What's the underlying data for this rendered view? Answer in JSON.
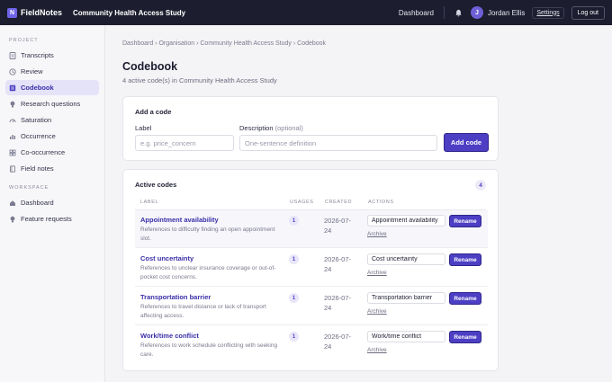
{
  "topbar": {
    "brand_initial": "N",
    "brand": "FieldNotes",
    "study_title": "Community Health Access Study",
    "dashboard": "Dashboard",
    "user_initial": "J",
    "user_name": "Jordan Ellis",
    "settings": "Settings",
    "logout": "Log out"
  },
  "sidebar": {
    "project_section": "PROJECT",
    "workspace_section": "WORKSPACE",
    "project_items": [
      {
        "label": "Transcripts",
        "icon": "document-icon"
      },
      {
        "label": "Review",
        "icon": "clock-icon"
      },
      {
        "label": "Codebook",
        "icon": "tag-icon"
      },
      {
        "label": "Research questions",
        "icon": "bulb-icon"
      },
      {
        "label": "Saturation",
        "icon": "gauge-icon"
      },
      {
        "label": "Occurrence",
        "icon": "bar-chart-icon"
      },
      {
        "label": "Co-occurrence",
        "icon": "grid-icon"
      },
      {
        "label": "Field notes",
        "icon": "notebook-icon"
      }
    ],
    "workspace_items": [
      {
        "label": "Dashboard",
        "icon": "home-icon"
      },
      {
        "label": "Feature requests",
        "icon": "bulb-icon"
      }
    ],
    "active_item": "Codebook"
  },
  "breadcrumb": "Dashboard › Organisation › Community Health Access Study › Codebook",
  "page": {
    "title": "Codebook",
    "subtitle": "4 active code(s) in Community Health Access Study"
  },
  "add_code": {
    "title": "Add a code",
    "label_label": "Label",
    "label_placeholder": "e.g. price_concern",
    "description_label": "Description",
    "description_optional": "(optional)",
    "description_placeholder": "One-sentence definition",
    "button": "Add code"
  },
  "active_codes": {
    "title": "Active codes",
    "count": "4",
    "columns": {
      "label": "LABEL",
      "usages": "USAGES",
      "created": "CREATED",
      "actions": "ACTIONS"
    },
    "rename_label": "Rename",
    "archive_label": "Archive",
    "rows": [
      {
        "label": "Appointment availability",
        "description": "References to difficulty finding an open appointment slot.",
        "usages": "1",
        "created": "2026-07-24",
        "rename_value": "Appointment availability"
      },
      {
        "label": "Cost uncertainty",
        "description": "References to unclear insurance coverage or out-of-pocket cost concerns.",
        "usages": "1",
        "created": "2026-07-24",
        "rename_value": "Cost uncertainty"
      },
      {
        "label": "Transportation barrier",
        "description": "References to travel distance or lack of transport affecting access.",
        "usages": "1",
        "created": "2026-07-24",
        "rename_value": "Transportation barrier"
      },
      {
        "label": "Work/time conflict",
        "description": "References to work schedule conflicting with seeking care.",
        "usages": "1",
        "created": "2026-07-24",
        "rename_value": "Work/time conflict"
      }
    ]
  },
  "colors": {
    "accent": "#4c3fc4",
    "topbar": "#1c1d2e",
    "active_bg": "#e5e3f8"
  }
}
